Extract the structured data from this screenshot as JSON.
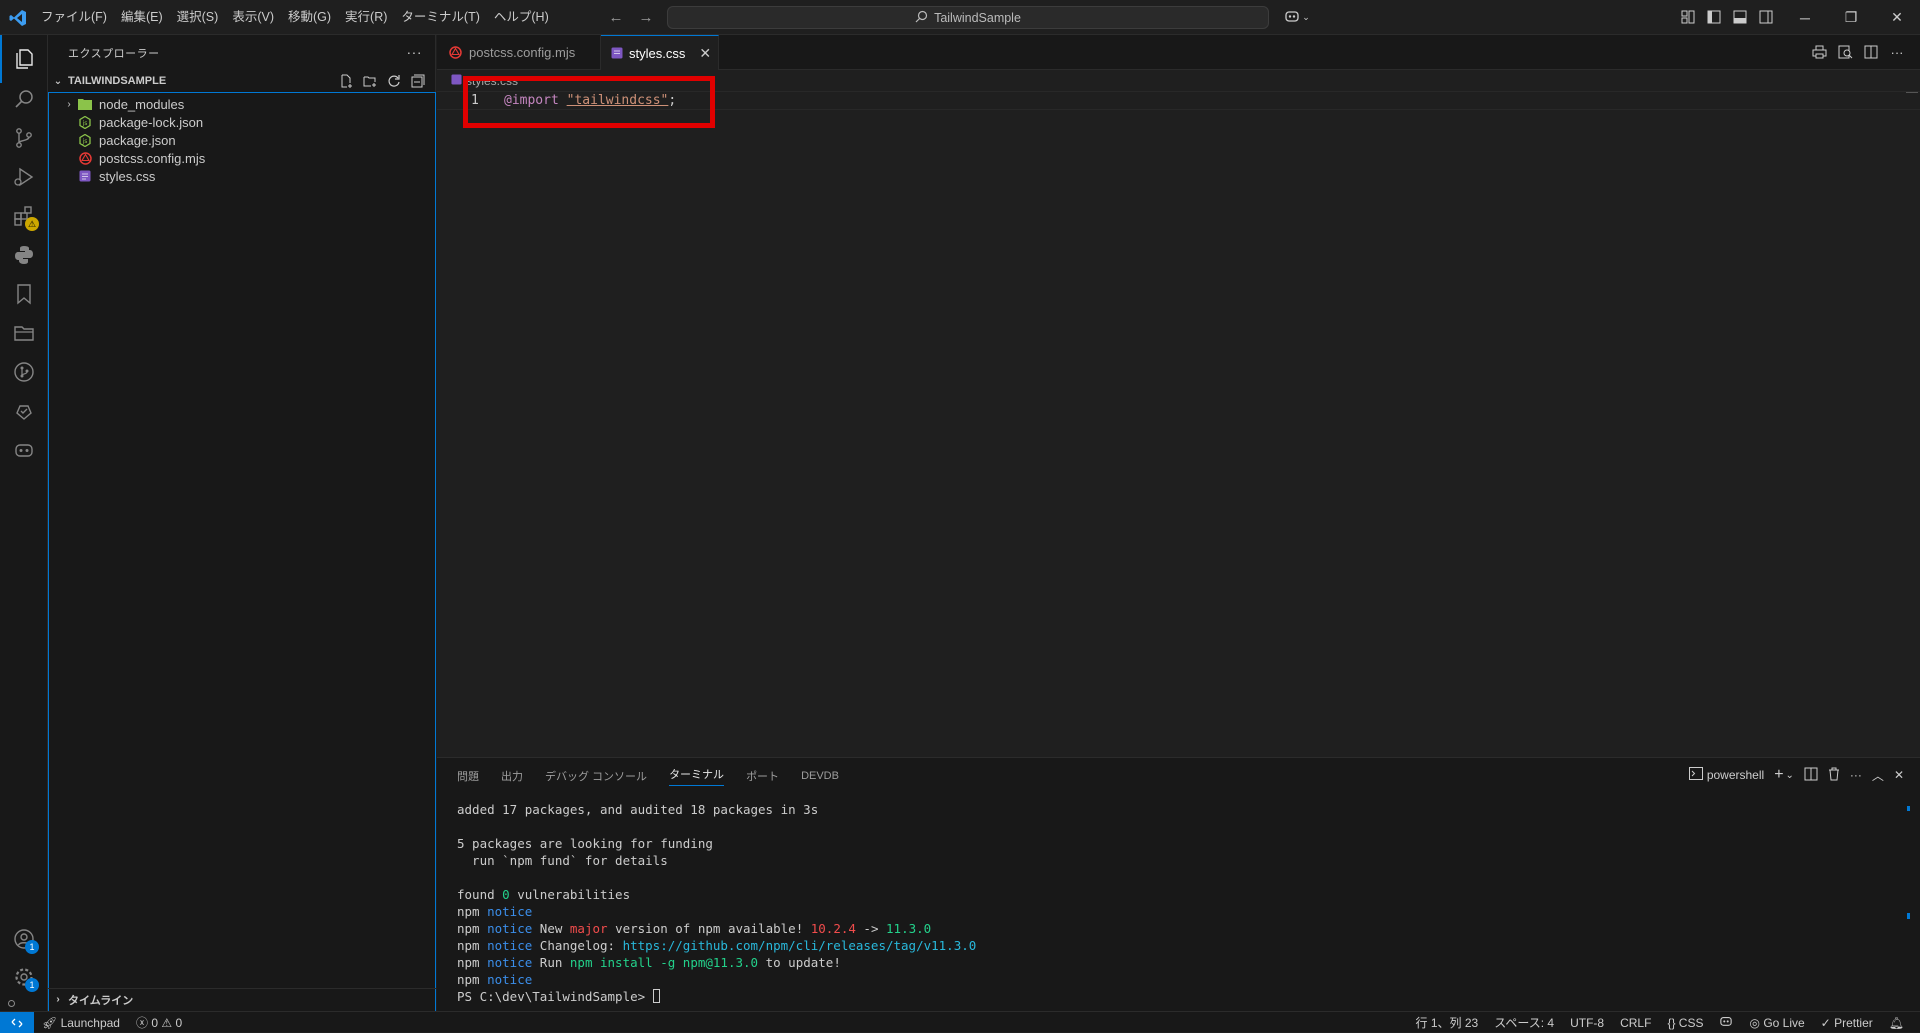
{
  "titlebar": {
    "menu": [
      "ファイル(F)",
      "編集(E)",
      "選択(S)",
      "表示(V)",
      "移動(G)",
      "実行(R)",
      "ターミナル(T)",
      "ヘルプ(H)"
    ],
    "search_text": "TailwindSample"
  },
  "activitybar": {
    "extensions_badge": "⚠",
    "accounts_badge": "1",
    "settings_badge": "1"
  },
  "sidebar": {
    "title": "エクスプローラー",
    "project": "TAILWINDSAMPLE",
    "items": [
      {
        "label": "node_modules",
        "type": "folder"
      },
      {
        "label": "package-lock.json",
        "type": "json"
      },
      {
        "label": "package.json",
        "type": "json"
      },
      {
        "label": "postcss.config.mjs",
        "type": "postcss"
      },
      {
        "label": "styles.css",
        "type": "css"
      }
    ],
    "timeline": "タイムライン"
  },
  "editor": {
    "tabs": [
      {
        "label": "postcss.config.mjs",
        "active": false
      },
      {
        "label": "styles.css",
        "active": true
      }
    ],
    "breadcrumb": "styles.css",
    "line_number": "1",
    "code": {
      "keyword": "@import",
      "string": "\"tailwindcss\"",
      "end": ";"
    }
  },
  "panel": {
    "tabs": [
      "問題",
      "出力",
      "デバッグ コンソール",
      "ターミナル",
      "ポート",
      "DEVDB"
    ],
    "active_tab": "ターミナル",
    "shell": "powershell",
    "terminal": {
      "line1": "added 17 packages, and audited 18 packages in 3s",
      "line2": "5 packages are looking for funding",
      "line3": "  run `npm fund` for details",
      "found_prefix": "found ",
      "found_count": "0",
      "found_suffix": " vulnerabilities",
      "npm": "npm",
      "notice": "notice",
      "new_prefix": " New ",
      "major": "major",
      "version_mid": " version of npm available! ",
      "old_version": "10.2.4",
      "arrow": " -> ",
      "new_version": "11.3.0",
      "changelog_label": " Changelog: ",
      "changelog_url": "https://github.com/npm/cli/releases/tag/v11.3.0",
      "run_label": " Run ",
      "run_cmd": "npm install -g npm@11.3.0",
      "run_suffix": " to update!",
      "prompt": "PS C:\\dev\\TailwindSample> "
    }
  },
  "statusbar": {
    "launchpad": "Launchpad",
    "errors": "0",
    "warnings": "0",
    "position": "行 1、列 23",
    "spaces": "スペース: 4",
    "encoding": "UTF-8",
    "eol": "CRLF",
    "language": "CSS",
    "golive": "Go Live",
    "prettier": "Prettier"
  },
  "colors": {
    "accent": "#0078d4",
    "highlight_box": "#e00000"
  }
}
